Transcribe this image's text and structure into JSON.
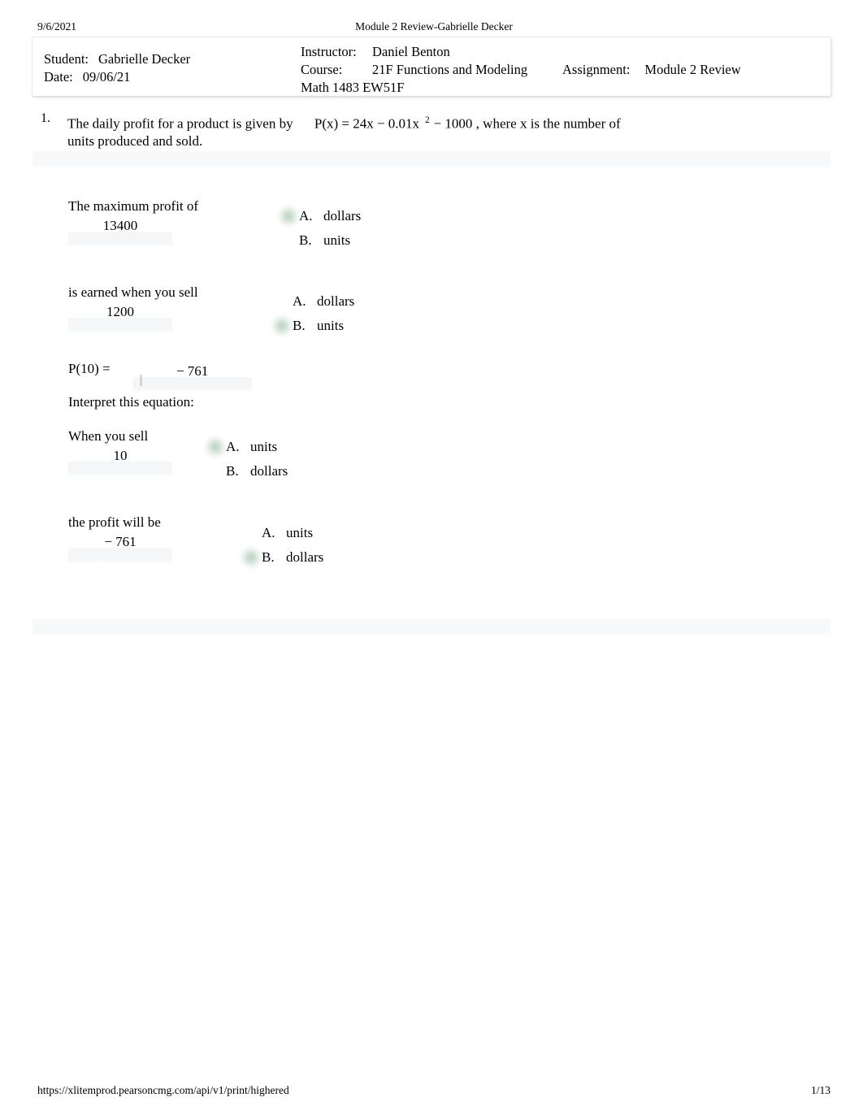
{
  "print_header": {
    "date": "9/6/2021",
    "title": "Module 2 Review-Gabrielle Decker"
  },
  "print_footer": {
    "url": "https://xlitemprod.pearsoncmg.com/api/v1/print/highered",
    "page": "1/13"
  },
  "info_box": {
    "student_label": "Student:",
    "student_value": "Gabrielle Decker",
    "date_label": "Date:",
    "date_value": "09/06/21",
    "instructor_label": "Instructor:",
    "instructor_value": "Daniel Benton",
    "course_label": "Course:",
    "course_value": "21F Functions and Modeling",
    "course_value2": "Math 1483 EW51F",
    "assignment_label": "Assignment:",
    "assignment_value": "Module 2 Review"
  },
  "question": {
    "number": "1.",
    "text_before": "The daily profit for a product is given by",
    "equation_lhs": "P(x) = 24x − 0.01x",
    "equation_sup": "2",
    "equation_rhs": "− 1000 , where x is the number",
    "text_after": "of units produced and sold."
  },
  "parts": [
    {
      "prompt": "The maximum profit of",
      "answer_value": "13400",
      "choices": [
        {
          "letter": "A.",
          "text": "dollars",
          "selected": true
        },
        {
          "letter": "B.",
          "text": "units",
          "selected": false
        }
      ]
    },
    {
      "prompt": "is earned when you sell",
      "answer_value": "1200",
      "choices": [
        {
          "letter": "A.",
          "text": "dollars",
          "selected": false
        },
        {
          "letter": "B.",
          "text": "units",
          "selected": true
        }
      ]
    },
    {
      "prompt": "When you sell",
      "answer_value": "10",
      "choices": [
        {
          "letter": "A.",
          "text": "units",
          "selected": true
        },
        {
          "letter": "B.",
          "text": "dollars",
          "selected": false
        }
      ]
    },
    {
      "prompt": "the profit will be",
      "answer_value": "− 761",
      "choices": [
        {
          "letter": "A.",
          "text": "units",
          "selected": false
        },
        {
          "letter": "B.",
          "text": "dollars",
          "selected": true
        }
      ]
    }
  ],
  "evaluation": {
    "label": "P(10) =",
    "value": "− 761",
    "interpret_label": "Interpret this equation:"
  }
}
